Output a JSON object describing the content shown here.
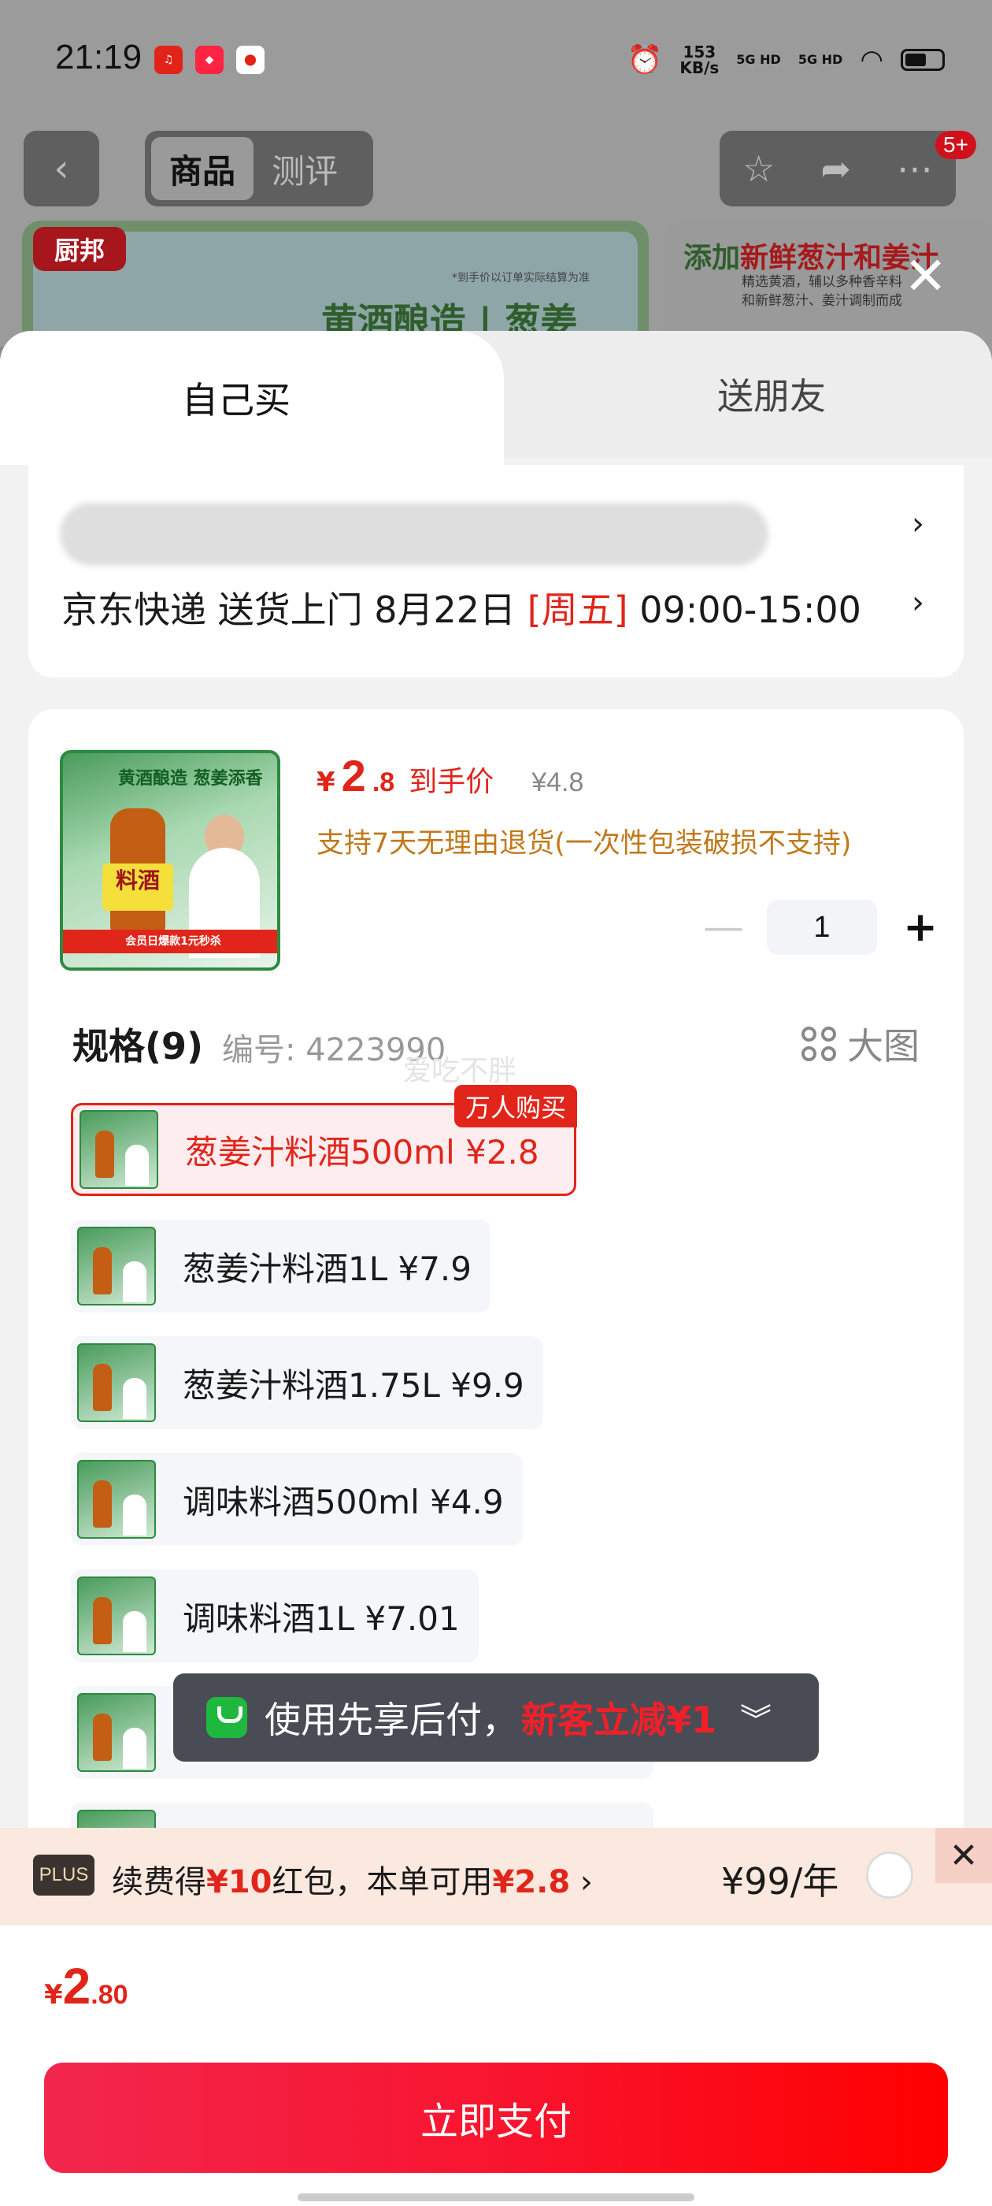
{
  "status_bar": {
    "time": "21:19",
    "speed_value": "153",
    "speed_unit": "KB/s",
    "signal1": "5G HD",
    "signal2": "5G HD"
  },
  "nav": {
    "tabs": [
      "商品",
      "测评"
    ],
    "badge": "5+"
  },
  "banner": {
    "brand": "厨邦",
    "left_title": "黄酒酿造 | 葱姜",
    "left_note": "*到手价以订单实际结算为准",
    "right_title_prefix": "添加",
    "right_title_highlight": "新鲜葱汁和姜汁",
    "right_sub_line1": "精选黄酒，辅以多种香辛料",
    "right_sub_line2": "和新鲜葱汁、姜汁调制而成"
  },
  "sheet": {
    "tabs": {
      "self": "自己买",
      "friend": "送朋友"
    },
    "delivery": {
      "text": "京东快递 送货上门 8月22日 ",
      "day": "[周五]",
      "time": " 09:00-15:00"
    },
    "product": {
      "image_text": "料酒",
      "image_top": "黄酒酿造 葱姜添香",
      "image_ribbon": "会员日爆款1元秒杀",
      "price_symbol": "¥",
      "price_int": "2",
      "price_dec": ".8",
      "price_label": "到手价",
      "original_price": "¥4.8",
      "return_policy": "支持7天无理由退货(一次性包装破损不支持)",
      "quantity": "1"
    },
    "spec": {
      "title": "规格(9)",
      "code": "编号: 4223990",
      "watermark": "爱吃不胖",
      "big_view": "大图",
      "items": [
        {
          "label": "葱姜汁料酒500ml  ¥2.8",
          "tag": "万人购买"
        },
        {
          "label": "葱姜汁料酒1L  ¥7.9"
        },
        {
          "label": "葱姜汁料酒1.75L  ¥9.9"
        },
        {
          "label": "调味料酒500ml  ¥4.9"
        },
        {
          "label": "调味料酒1L  ¥7.01"
        }
      ]
    },
    "toast": {
      "text": "使用先享后付，",
      "highlight": "新客立减¥1"
    },
    "plus": {
      "badge": "PLUS",
      "t1": "续费得",
      "r1": "¥10",
      "t2": "红包，本单可用",
      "r2": "¥2.8",
      "price": "¥99/年"
    },
    "total": {
      "sym": "¥",
      "int": "2",
      "dec": ".80"
    },
    "pay_button": "立即支付"
  }
}
